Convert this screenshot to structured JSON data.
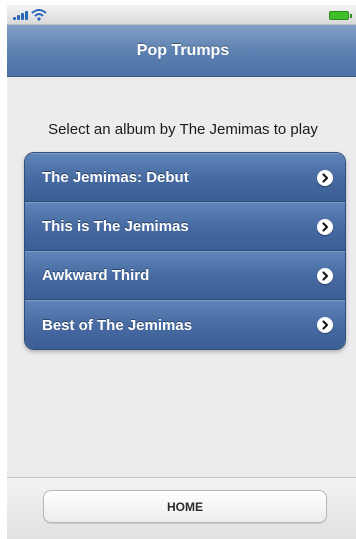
{
  "status_bar": {
    "signal_icon": "signal-bars-icon",
    "wifi_icon": "wifi-icon",
    "battery_icon": "battery-icon",
    "battery_color": "#3fbf2a"
  },
  "header": {
    "title": "Pop Trumps"
  },
  "main": {
    "prompt": "Select an album by The Jemimas to play",
    "albums": [
      {
        "label": "The Jemimas: Debut",
        "icon": "chevron-right-circle-icon"
      },
      {
        "label": "This is The Jemimas",
        "icon": "chevron-right-circle-icon"
      },
      {
        "label": "Awkward Third",
        "icon": "chevron-right-circle-icon"
      },
      {
        "label": "Best of The Jemimas",
        "icon": "chevron-right-circle-icon"
      }
    ]
  },
  "footer": {
    "home_label": "HOME"
  },
  "colors": {
    "nav_bar": "#5b7fb0",
    "list_item": "#4569a0",
    "background": "#ececee"
  }
}
